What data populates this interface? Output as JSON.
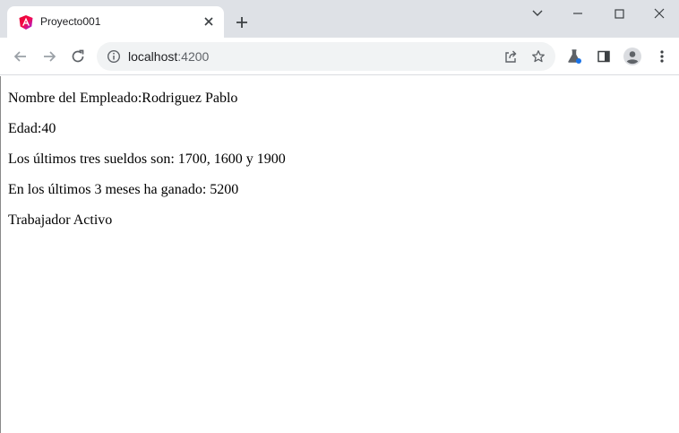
{
  "browser": {
    "tab": {
      "title": "Proyecto001",
      "icon": "angular-icon"
    },
    "address": {
      "host": "localhost",
      "port": ":4200"
    },
    "colors": {
      "tabstrip": "#dee1e6",
      "omnibox": "#f1f3f4",
      "accent": "#1a73e8"
    }
  },
  "content": {
    "nombre": "Nombre del Empleado:Rodriguez Pablo",
    "edad": "Edad:40",
    "sueldos": "Los últimos tres sueldos son: 1700, 1600 y 1900",
    "ganado": "En los últimos 3 meses ha ganado: 5200",
    "estado": "Trabajador Activo"
  }
}
